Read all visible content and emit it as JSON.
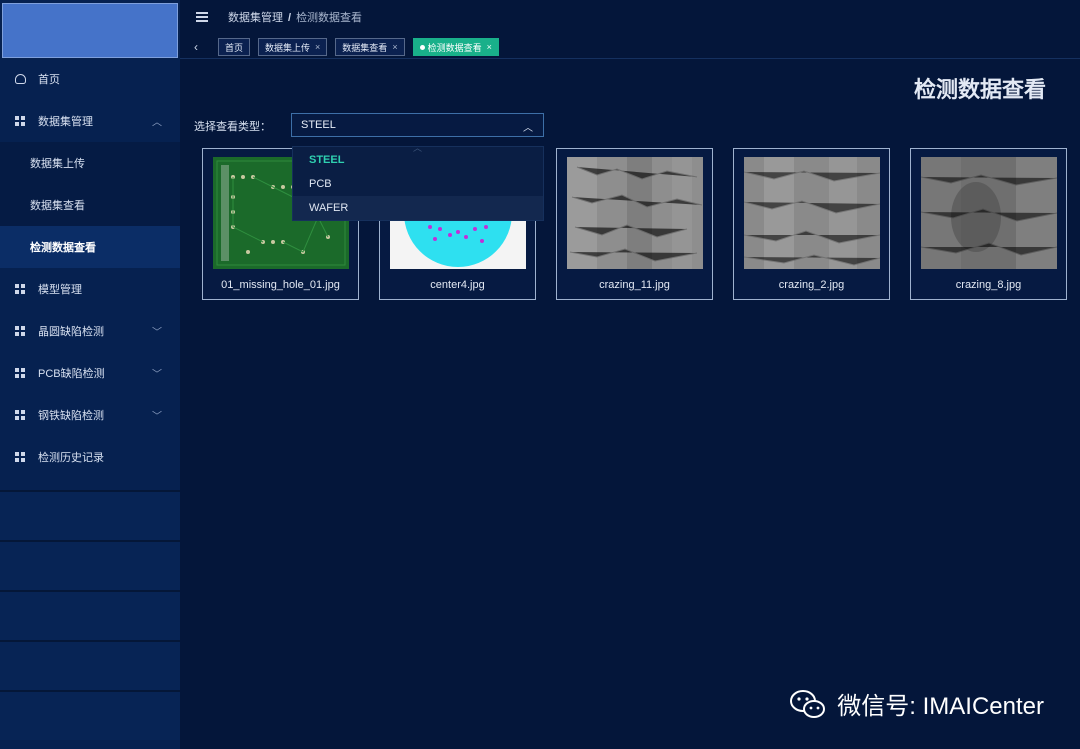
{
  "breadcrumb": {
    "parent": "数据集管理",
    "separator": "/",
    "current": "检测数据查看"
  },
  "tabs": [
    {
      "label": "首页",
      "active": false,
      "closable": false
    },
    {
      "label": "数据集上传",
      "active": false,
      "closable": true
    },
    {
      "label": "数据集查看",
      "active": false,
      "closable": true
    },
    {
      "label": "检测数据查看",
      "active": true,
      "closable": true
    }
  ],
  "sidebar": {
    "items": [
      {
        "label": "首页",
        "icon": "home-icon"
      },
      {
        "label": "数据集管理",
        "icon": "grid-icon",
        "expanded": true,
        "children": [
          "数据集上传",
          "数据集查看",
          "检测数据查看"
        ],
        "active_child": "检测数据查看"
      },
      {
        "label": "模型管理",
        "icon": "grid-icon"
      },
      {
        "label": "晶圆缺陷检测",
        "icon": "grid-icon",
        "has_children": true
      },
      {
        "label": "PCB缺陷检测",
        "icon": "grid-icon",
        "has_children": true
      },
      {
        "label": "钢铁缺陷检测",
        "icon": "grid-icon",
        "has_children": true
      },
      {
        "label": "检测历史记录",
        "icon": "grid-icon"
      }
    ]
  },
  "main": {
    "title": "检测数据查看",
    "select": {
      "label": "选择查看类型：",
      "value": "STEEL",
      "options": [
        "STEEL",
        "PCB",
        "WAFER"
      ],
      "hovered": "WAFER"
    },
    "images": [
      {
        "caption": "01_missing_hole_01.jpg",
        "kind": "pcb"
      },
      {
        "caption": "center4.jpg",
        "kind": "wafer"
      },
      {
        "caption": "crazing_11.jpg",
        "kind": "steel"
      },
      {
        "caption": "crazing_2.jpg",
        "kind": "steel"
      },
      {
        "caption": "crazing_8.jpg",
        "kind": "steel"
      }
    ]
  },
  "watermark": {
    "text": "微信号: IMAICenter"
  },
  "colors": {
    "background": "#04163a",
    "sidebar": "#062150",
    "accent": "#19b08a",
    "logo": "#4573c9"
  }
}
